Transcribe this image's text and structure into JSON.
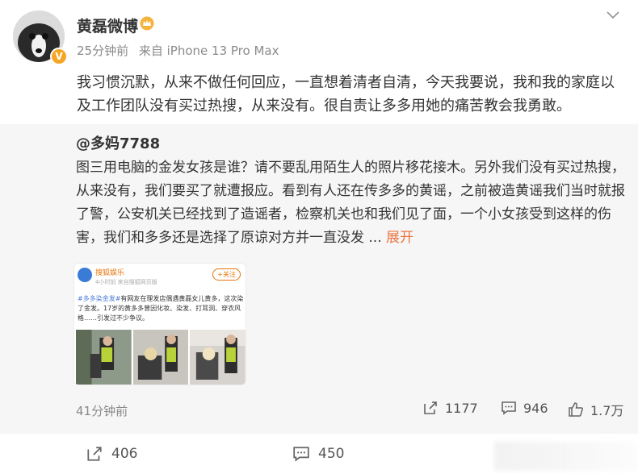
{
  "post": {
    "author": "黄磊微博",
    "time": "25分钟前",
    "source": "来自 iPhone 13 Pro Max",
    "text": "我习惯沉默，从来不做任何回应，一直想着清者自清，今天我要说，我和我的家庭以及工作团队没有买过热搜，从来没有。很自责让多多用她的痛苦教会我勇敢。"
  },
  "quote": {
    "author": "@多妈7788",
    "text": "图三用电脑的金发女孩是谁？请不要乱用陌生人的照片移花接木。另外我们没有买过热搜，从来没有，我们要买了就遭报应。看到有人还在传多多的黄谣，之前被造黄谣我们当时就报了警，公安机关已经找到了造谣者，检察机关也和我们见了面，一个小女孩受到这样的伤害，我们和多多还是选择了原谅对方并一直没发",
    "ellipsis": " ... ",
    "expand": "展开",
    "time": "41分钟前",
    "actions": {
      "repost": "1177",
      "comment": "946",
      "like": "1.7万"
    },
    "image": {
      "name": "搜狐娱乐",
      "meta": "4小时前 来自搜狐网页版",
      "follow": "+关注",
      "tag": "#多多染金发#",
      "text": "有网友在理发店偶遇黄磊女儿黄多，这次染了金发。17岁的黄多多曾因化妆、染发、打耳洞、穿衣风格……引发过不少争议。"
    }
  },
  "bottom": {
    "repost": "406",
    "comment": "450"
  },
  "colors": {
    "accent": "#eb7340",
    "verify": "#f5a623",
    "quote_bg": "#f6f6f6"
  }
}
